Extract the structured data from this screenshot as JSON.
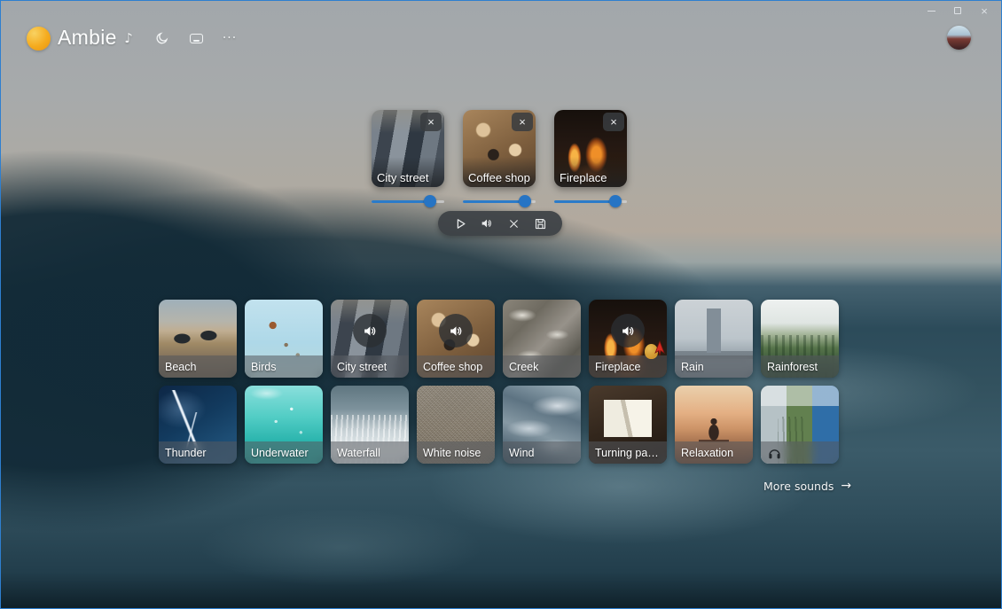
{
  "app": {
    "title": "Ambie"
  },
  "titlebar": {
    "buttons": [
      "minimize",
      "maximize",
      "close"
    ]
  },
  "symbols": {
    "close_glyph": "×",
    "more_arrow": "→"
  },
  "header": {
    "icons": [
      {
        "name": "music-note-icon",
        "glyph": "♪"
      },
      {
        "name": "sleep-timer-moon-icon"
      },
      {
        "name": "mini-player-icon"
      },
      {
        "name": "more-options-icon",
        "glyph": "···"
      }
    ]
  },
  "active_sounds": [
    {
      "label": "City street",
      "img": "city-street",
      "volume": 80
    },
    {
      "label": "Coffee shop",
      "img": "coffee-shop",
      "volume": 85
    },
    {
      "label": "Fireplace",
      "img": "fireplace",
      "volume": 84
    }
  ],
  "player_bar": {
    "buttons": [
      {
        "name": "play-button"
      },
      {
        "name": "global-volume-button"
      },
      {
        "name": "clear-active-sounds-button"
      },
      {
        "name": "save-mix-button"
      }
    ]
  },
  "catalog": {
    "tiles": [
      {
        "id": "beach",
        "label": "Beach",
        "playing": false
      },
      {
        "id": "birds",
        "label": "Birds",
        "playing": false
      },
      {
        "id": "city-street",
        "label": "City street",
        "playing": true
      },
      {
        "id": "coffee-shop",
        "label": "Coffee shop",
        "playing": true
      },
      {
        "id": "creek",
        "label": "Creek",
        "playing": false
      },
      {
        "id": "fireplace",
        "label": "Fireplace",
        "playing": true
      },
      {
        "id": "rain",
        "label": "Rain",
        "playing": false
      },
      {
        "id": "rainforest",
        "label": "Rainforest",
        "playing": false
      },
      {
        "id": "thunder",
        "label": "Thunder",
        "playing": false
      },
      {
        "id": "underwater",
        "label": "Underwater",
        "playing": false
      },
      {
        "id": "waterfall",
        "label": "Waterfall",
        "playing": false
      },
      {
        "id": "white-noise",
        "label": "White noise",
        "playing": false
      },
      {
        "id": "wind",
        "label": "Wind",
        "playing": false
      },
      {
        "id": "turning-pages",
        "label": "Turning pa…",
        "playing": false
      },
      {
        "id": "relaxation",
        "label": "Relaxation",
        "playing": false
      },
      {
        "id": "mix",
        "label": "",
        "playing": false,
        "icon": "headphones-icon"
      }
    ]
  },
  "footer": {
    "more_sounds": "More sounds"
  },
  "colors": {
    "accent_blue": "#2b7bc9",
    "pill_bg": "#3c4145",
    "logo_orange": "#f5ab1e"
  }
}
